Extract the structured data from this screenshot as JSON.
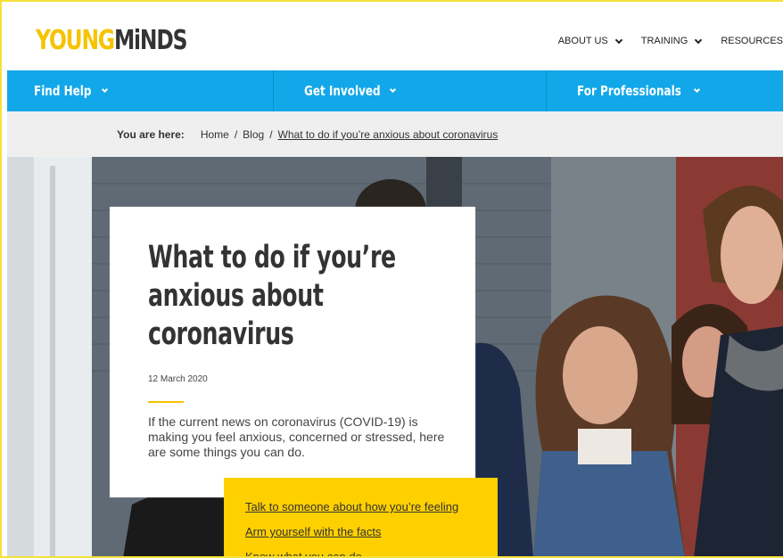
{
  "header": {
    "logo_young": "YOUNG",
    "logo_minds": "MiNDS",
    "top_nav": [
      "ABOUT US",
      "TRAINING",
      "RESOURCES"
    ]
  },
  "main_nav": [
    "Find Help",
    "Get Involved",
    "For Professionals"
  ],
  "breadcrumb": {
    "prefix": "You are here:",
    "items": [
      "Home",
      "Blog",
      "What to do if you’re anxious about coronavirus"
    ],
    "separator": "/"
  },
  "article": {
    "title": "What to do if you’re anxious about coronavirus",
    "date": "12 March 2020",
    "intro": "If the current news on coronavirus (COVID-19) is making you feel anxious, concerned or stressed, here are some things you can do."
  },
  "jump_links": [
    "Talk to someone about how you’re feeling",
    "Arm yourself with the facts",
    "Know what you can do"
  ],
  "colors": {
    "brand_yellow": "#f5c300",
    "nav_blue": "#12a7e8",
    "links_box": "#ffd000"
  }
}
